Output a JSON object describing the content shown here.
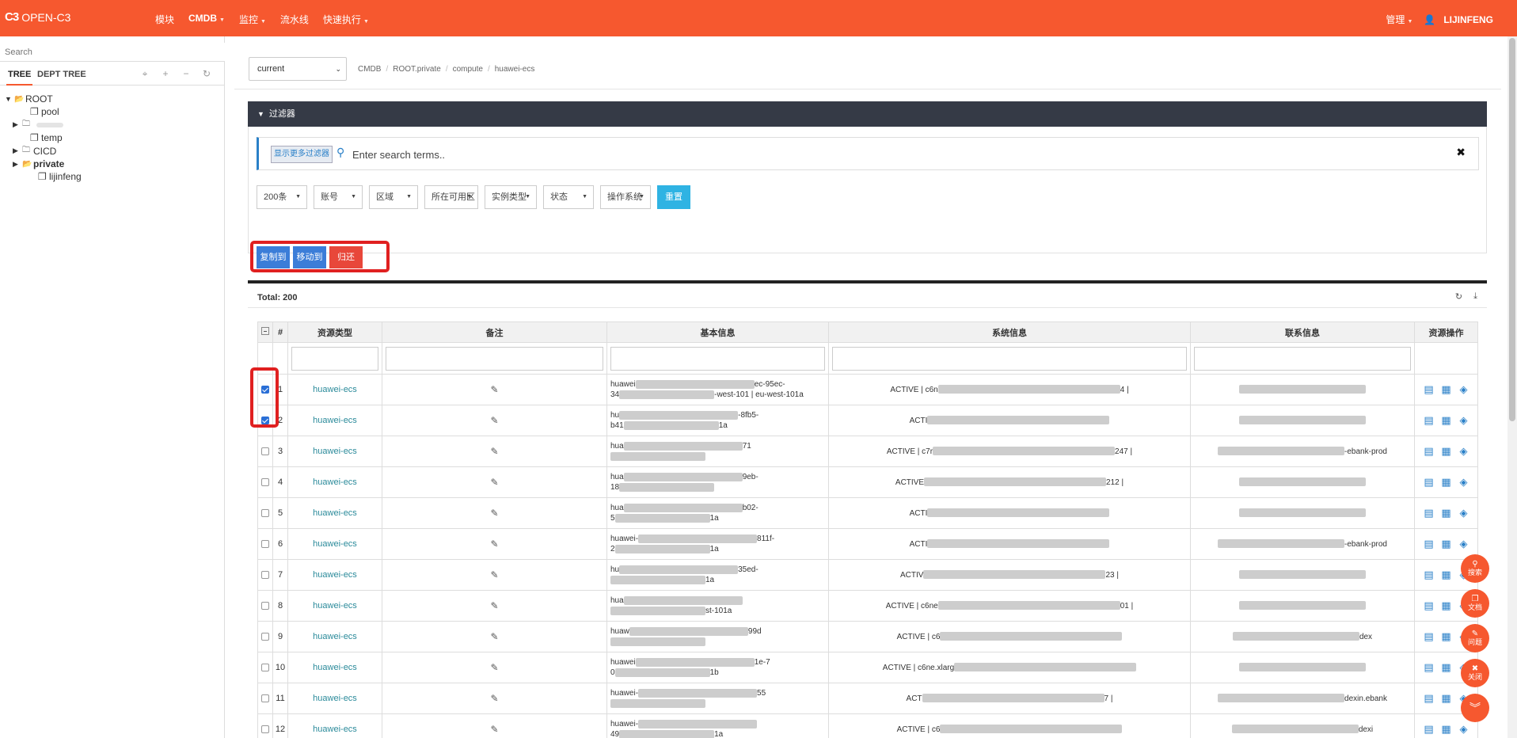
{
  "brand": {
    "logo": "C3",
    "name": "OPEN-C3"
  },
  "topnav": [
    {
      "label": "模块",
      "caret": false,
      "active": false
    },
    {
      "label": "CMDB",
      "caret": true,
      "active": true
    },
    {
      "label": "监控",
      "caret": true,
      "active": false
    },
    {
      "label": "流水线",
      "caret": false,
      "active": false
    },
    {
      "label": "快速执行",
      "caret": true,
      "active": false
    }
  ],
  "topright": {
    "manage": "管理",
    "user": "LIJINFENG"
  },
  "sidebar": {
    "search_placeholder": "Search",
    "tabs": [
      "TREE",
      "DEPT TREE"
    ],
    "tree": [
      {
        "label": "ROOT",
        "indent": 0,
        "arrow": "down",
        "icon": "folder-open",
        "bold": false
      },
      {
        "label": "pool",
        "indent": 2,
        "arrow": "",
        "icon": "copy",
        "bold": false
      },
      {
        "label": "",
        "indent": 1,
        "arrow": "right",
        "icon": "folder",
        "bold": false
      },
      {
        "label": "temp",
        "indent": 2,
        "arrow": "",
        "icon": "copy",
        "bold": false
      },
      {
        "label": "CICD",
        "indent": 1,
        "arrow": "right",
        "icon": "folder",
        "bold": false
      },
      {
        "label": "private",
        "indent": 1,
        "arrow": "right",
        "icon": "folder-open",
        "bold": true
      },
      {
        "label": "lijinfeng",
        "indent": 3,
        "arrow": "",
        "icon": "copy",
        "bold": false
      }
    ]
  },
  "env_select": "current",
  "breadcrumb": [
    "CMDB",
    "ROOT.private",
    "compute",
    "huawei-ecs"
  ],
  "filter": {
    "title": "过滤器",
    "more_button": "显示更多过滤器",
    "search_placeholder": "Enter search terms..",
    "dropdowns": [
      "200条",
      "账号",
      "区域",
      "所在可用区",
      "实例类型",
      "状态",
      "操作系统"
    ],
    "reset": "重置"
  },
  "actions": {
    "copy": "复制到",
    "move": "移动到",
    "return": "归还"
  },
  "total": "Total: 200",
  "table": {
    "columns": [
      "#",
      "资源类型",
      "备注",
      "基本信息",
      "系统信息",
      "联系信息",
      "资源操作"
    ],
    "rows": [
      {
        "n": "1",
        "type": "huawei-ecs",
        "checked": true,
        "basic1": "huawei",
        "basic1b": "ec-95ec-",
        "basic2": "34",
        "basic2b": "-west-101 | eu-west-101a",
        "sys": "ACTIVE | c6n",
        "sys_tail": "4 |",
        "contact": ""
      },
      {
        "n": "2",
        "type": "huawei-ecs",
        "checked": true,
        "basic1": "hu",
        "basic1b": "-8fb5-",
        "basic2": "b41",
        "basic2b": "1a",
        "sys": "ACTI",
        "sys_tail": "",
        "contact": ""
      },
      {
        "n": "3",
        "type": "huawei-ecs",
        "checked": false,
        "basic1": "hua",
        "basic1b": "71",
        "basic2": "",
        "basic2b": "",
        "sys": "ACTIVE | c7r",
        "sys_tail": "247 |",
        "contact": "-ebank-prod"
      },
      {
        "n": "4",
        "type": "huawei-ecs",
        "checked": false,
        "basic1": "hua",
        "basic1b": "9eb-",
        "basic2": "18",
        "basic2b": "",
        "sys": "ACTIVE",
        "sys_tail": "212 |",
        "contact": ""
      },
      {
        "n": "5",
        "type": "huawei-ecs",
        "checked": false,
        "basic1": "hua",
        "basic1b": "b02-",
        "basic2": "5",
        "basic2b": "1a",
        "sys": "ACTI",
        "sys_tail": "",
        "contact": ""
      },
      {
        "n": "6",
        "type": "huawei-ecs",
        "checked": false,
        "basic1": "huawei-",
        "basic1b": "811f-",
        "basic2": "2",
        "basic2b": "1a",
        "sys": "ACTI",
        "sys_tail": "",
        "contact": "-ebank-prod"
      },
      {
        "n": "7",
        "type": "huawei-ecs",
        "checked": false,
        "basic1": "hu",
        "basic1b": "35ed-",
        "basic2": "",
        "basic2b": "1a",
        "sys": "ACTIV",
        "sys_tail": "23 |",
        "contact": ""
      },
      {
        "n": "8",
        "type": "huawei-ecs",
        "checked": false,
        "basic1": "hua",
        "basic1b": "",
        "basic2": "",
        "basic2b": "st-101a",
        "sys": "ACTIVE | c6ne",
        "sys_tail": "01 |",
        "contact": ""
      },
      {
        "n": "9",
        "type": "huawei-ecs",
        "checked": false,
        "basic1": "huaw",
        "basic1b": "99d",
        "basic2": "",
        "basic2b": "",
        "sys": "ACTIVE | c6",
        "sys_tail": "",
        "contact": "dex"
      },
      {
        "n": "10",
        "type": "huawei-ecs",
        "checked": false,
        "basic1": "huawei",
        "basic1b": "1e-7",
        "basic2": "0",
        "basic2b": "1b",
        "sys": "ACTIVE | c6ne.xlarg",
        "sys_tail": "",
        "contact": ""
      },
      {
        "n": "11",
        "type": "huawei-ecs",
        "checked": false,
        "basic1": "huawei-",
        "basic1b": "55",
        "basic2": "",
        "basic2b": "",
        "sys": "ACT",
        "sys_tail": "7 |",
        "contact": "dexin.ebank"
      },
      {
        "n": "12",
        "type": "huawei-ecs",
        "checked": false,
        "basic1": "huawei-",
        "basic1b": "",
        "basic2": "49",
        "basic2b": "1a",
        "sys": "ACTIVE | c6",
        "sys_tail": "",
        "contact": "dexi"
      }
    ]
  },
  "float_buttons": [
    {
      "label": "搜索",
      "icon": "search-icon"
    },
    {
      "label": "文档",
      "icon": "doc-icon"
    },
    {
      "label": "问题",
      "icon": "edit-icon"
    },
    {
      "label": "关闭",
      "icon": "close-icon"
    },
    {
      "label": "",
      "icon": "double-chevron-down-icon"
    }
  ],
  "colors": {
    "brand": "#f6582f",
    "primary": "#2a80c8",
    "danger": "#e8473a",
    "reset": "#2fb3e3",
    "highlight": "#e02020"
  }
}
